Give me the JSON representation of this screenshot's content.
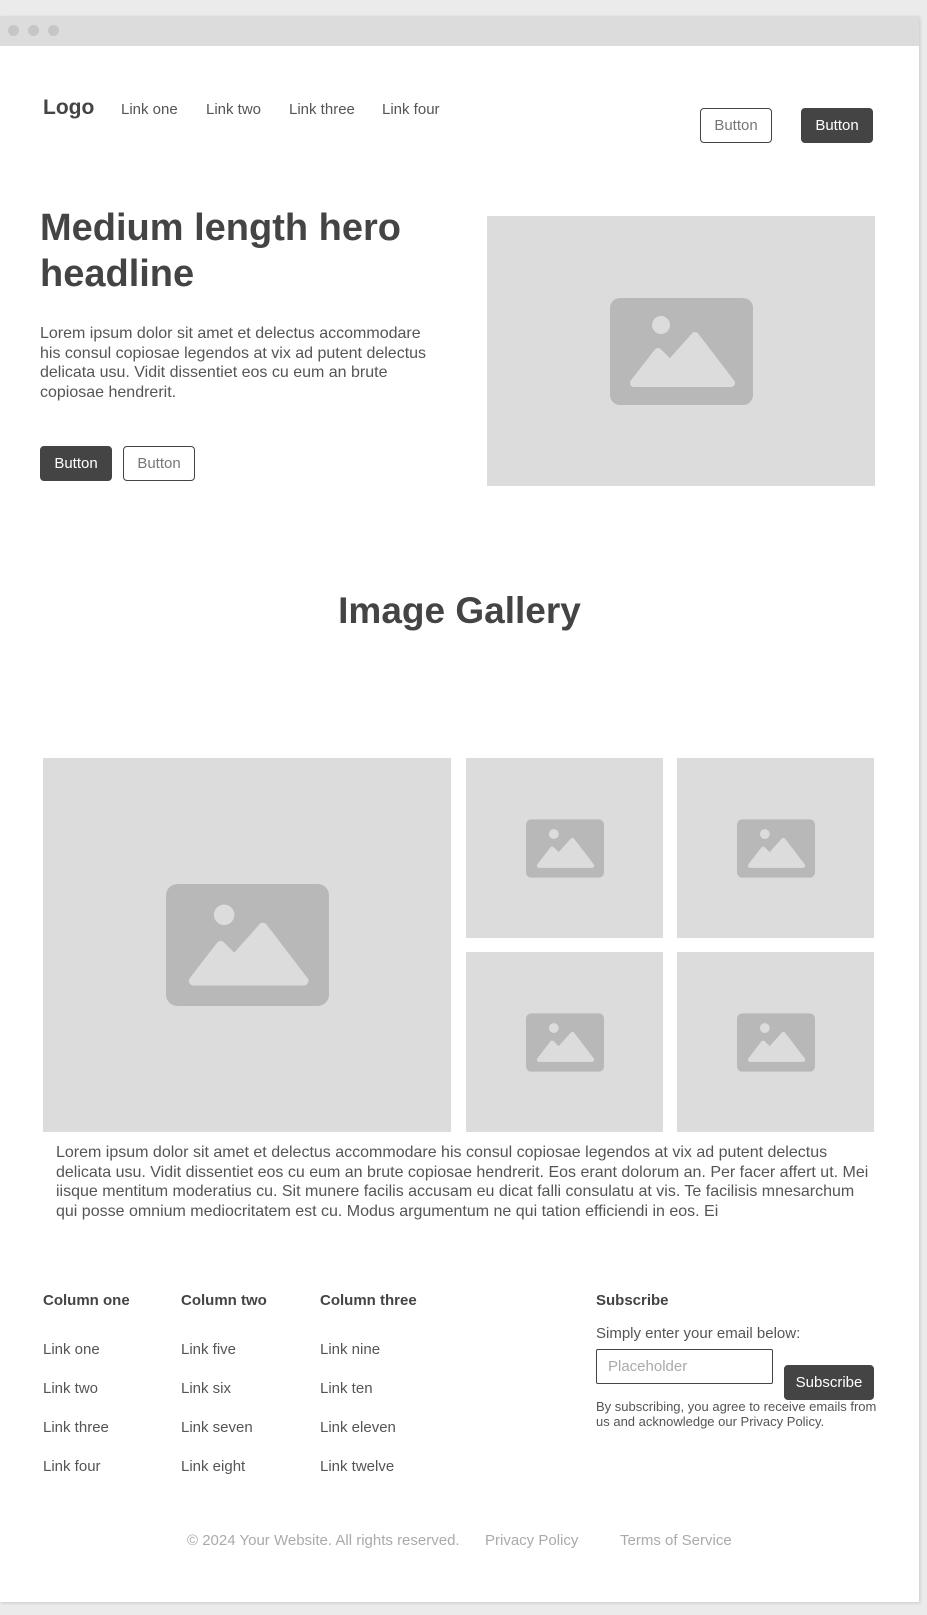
{
  "nav": {
    "logo": "Logo",
    "links": [
      "Link one",
      "Link two",
      "Link three",
      "Link four"
    ],
    "button_outline": "Button",
    "button_dark": "Button"
  },
  "hero": {
    "headline": "Medium length hero headline",
    "body": "Lorem ipsum dolor sit amet et delectus accommodare his consul copiosae legendos at vix ad putent delectus delicata usu. Vidit dissentiet eos cu eum an brute copiosae hendrerit.",
    "button_primary": "Button",
    "button_secondary": "Button"
  },
  "gallery": {
    "title": "Image Gallery",
    "text": "Lorem ipsum dolor sit amet et delectus accommodare his consul copiosae legendos at vix ad putent delectus delicata usu. Vidit dissentiet eos cu eum an brute copiosae hendrerit. Eos erant dolorum an. Per facer affert ut. Mei iisque mentitum moderatius cu. Sit munere facilis accusam eu dicat falli consulatu at vis. Te facilisis mnesarchum qui posse omnium mediocritatem est cu. Modus argumentum ne qui tation efficiendi in eos. Ei"
  },
  "footer": {
    "columns": [
      {
        "heading": "Column one",
        "links": [
          "Link one",
          "Link two",
          "Link three",
          "Link four"
        ]
      },
      {
        "heading": "Column two",
        "links": [
          "Link five",
          "Link six",
          "Link seven",
          "Link eight"
        ]
      },
      {
        "heading": "Column three",
        "links": [
          "Link nine",
          "Link ten",
          "Link eleven",
          "Link twelve"
        ]
      }
    ],
    "subscribe": {
      "heading": "Subscribe",
      "text": "Simply enter your email below:",
      "placeholder": "Placeholder",
      "button": "Subscribe",
      "disclaimer": "By subscribing, you agree to receive emails from us and acknowledge our Privacy Policy."
    },
    "copyright": "© 2024 Your Website. All rights reserved.",
    "privacy": "Privacy Policy",
    "terms": "Terms of Service"
  },
  "icons": {
    "placeholder": "image-placeholder-icon"
  },
  "colors": {
    "dark": "#444444",
    "placeholder_bg": "#dcdcdc",
    "placeholder_icon": "#b8b8b8"
  }
}
